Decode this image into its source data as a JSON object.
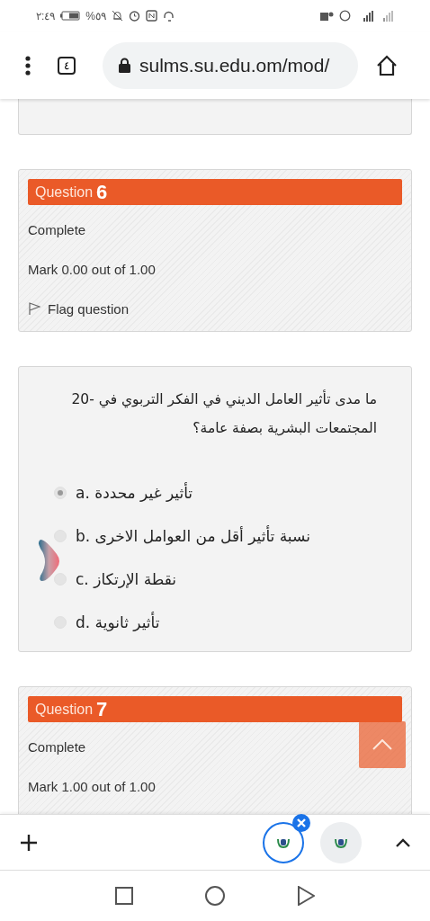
{
  "status_bar": {
    "time": "٢:٤٩",
    "battery": "%٥٩"
  },
  "browser": {
    "tab_count": "٤",
    "url": "sulms.su.edu.om/mod/"
  },
  "questions": [
    {
      "kind": "info",
      "label": "Question",
      "number": "6",
      "state": "Complete",
      "mark": "Mark 0.00 out of 1.00",
      "flag": "Flag question"
    },
    {
      "kind": "content",
      "text": "ما مدى تأثير العامل الديني في الفكر التربوي في -20 المجتمعات البشرية بصفة عامة؟",
      "options": [
        {
          "letter": "a.",
          "text": "تأثير غير محددة",
          "selected": true
        },
        {
          "letter": "b.",
          "text": "نسبة تأثير أقل من العوامل الاخرى",
          "selected": false
        },
        {
          "letter": "c.",
          "text": "نقطة الإرتكاز",
          "selected": false
        },
        {
          "letter": "d.",
          "text": "تأثير ثانوية",
          "selected": false
        }
      ]
    },
    {
      "kind": "info",
      "label": "Question",
      "number": "7",
      "state": "Complete",
      "mark": "Mark 1.00 out of 1.00"
    }
  ],
  "tab_strip": {
    "tabs": [
      {
        "selected": true
      },
      {
        "selected": false
      }
    ]
  }
}
